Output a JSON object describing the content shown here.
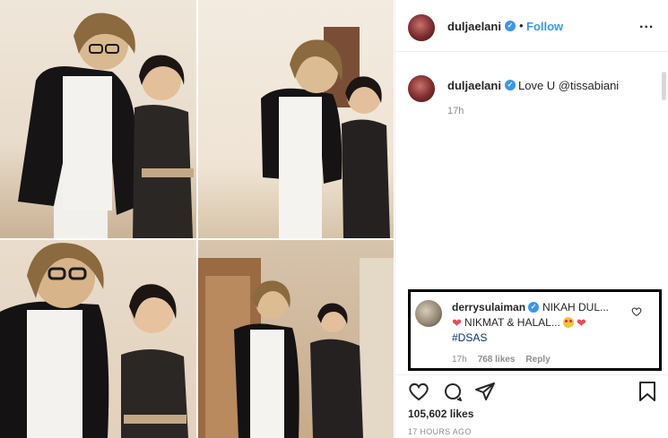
{
  "post": {
    "username": "duljaelani",
    "verified": true,
    "dot": "•",
    "follow_label": "Follow",
    "more_label": "..."
  },
  "caption": {
    "username": "duljaelani",
    "text": "Love U @tissabiani",
    "time": "17h"
  },
  "comment": {
    "username": "derrysulaiman",
    "line1": "NIKAH DUL...",
    "line2": "NIKMAT & HALAL...",
    "hashtag": "#DSAS",
    "time": "17h",
    "likes": "768 likes",
    "reply_label": "Reply"
  },
  "footer": {
    "likes": "105,602 likes",
    "time_ago": "17 HOURS AGO"
  },
  "colors": {
    "accent": "#3897f0",
    "highlight_border": "#000000",
    "heart": "#ed4956"
  },
  "icons": [
    "verified-badge-icon",
    "more-icon",
    "heart-icon",
    "comment-icon",
    "share-icon",
    "bookmark-icon",
    "heart-emoji-icon",
    "star-eyes-emoji-icon"
  ]
}
